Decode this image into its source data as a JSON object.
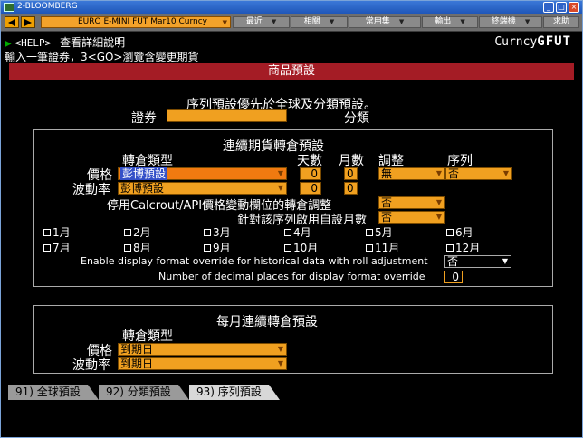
{
  "window": {
    "title": "2-BLOOMBERG"
  },
  "toolbar": {
    "security": "EURO E-MINI FUT Mar10 Curncy",
    "menus": [
      "最近",
      "相關",
      "常用集",
      "輸出",
      "終端機",
      "求助"
    ]
  },
  "help": {
    "key": "<HELP>",
    "text": "查看詳細說明"
  },
  "ticker": {
    "prefix": "Curncy",
    "code": "GFUT"
  },
  "instruction": "輸入一筆證券，3<GO>瀏覽含變更期貨",
  "header_bar": "商品預設",
  "note": "序列預設優先於全球及分類預設。",
  "security_label": "證券",
  "category_label": "分類",
  "continuous": {
    "title": "連續期貨轉倉預設",
    "col_roll_type": "轉倉類型",
    "col_days": "天數",
    "col_months": "月數",
    "col_adjust": "調整",
    "col_series": "序列",
    "rows": [
      {
        "label": "價格",
        "roll_type": "彭博預設",
        "days": "0",
        "months": "0",
        "adjust": "無",
        "series": "否"
      },
      {
        "label": "波動率",
        "roll_type": "彭博預設",
        "days": "0",
        "months": "0"
      }
    ],
    "disable_roll_label": "停用Calcrout/API價格變動欄位的轉倉調整",
    "disable_roll_value": "否",
    "custom_months_label": "針對該序列啟用自設月數",
    "custom_months_value": "否",
    "months": [
      "1月",
      "2月",
      "3月",
      "4月",
      "5月",
      "6月",
      "7月",
      "8月",
      "9月",
      "10月",
      "11月",
      "12月"
    ],
    "override_label": "Enable display format override for historical data with roll adjustment",
    "override_value": "否",
    "decimal_label": "Number of decimal places for display format override",
    "decimal_value": "0"
  },
  "monthly": {
    "title": "每月連續轉倉預設",
    "col_roll_type": "轉倉類型",
    "rows": [
      {
        "label": "價格",
        "roll_type": "到期日"
      },
      {
        "label": "波動率",
        "roll_type": "到期日"
      }
    ]
  },
  "tabs": [
    "91) 全球預設",
    "92) 分類預設",
    "93) 序列預設"
  ],
  "colors": {
    "accent": "#f0a020",
    "header": "#a41c25",
    "background": "#000000"
  }
}
